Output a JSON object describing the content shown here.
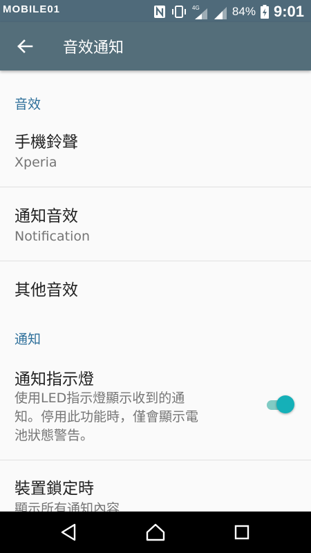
{
  "status_bar": {
    "watermark": "MOBILE01",
    "battery": "84%",
    "time": "9:01",
    "network": "4G",
    "icons": [
      "nfc-icon",
      "vibrate-icon",
      "signal-icon",
      "battery-icon"
    ]
  },
  "toolbar": {
    "back_icon": "arrow-left-icon",
    "title": "音效通知"
  },
  "sections": {
    "sound": {
      "header": "音效",
      "ringtone": {
        "title": "手機鈴聲",
        "value": "Xperia"
      },
      "notification_sound": {
        "title": "通知音效",
        "value": "Notification"
      },
      "other_sounds": {
        "title": "其他音效"
      }
    },
    "notification": {
      "header": "通知",
      "led": {
        "title": "通知指示燈",
        "summary_lines": [
          "使用LED指示燈顯示收到的通",
          "知。停用此功能時，僅會顯示電",
          "池狀態警告。"
        ],
        "enabled": true
      },
      "lock_screen": {
        "title": "裝置鎖定時",
        "value": "顯示所有通知內容"
      }
    }
  },
  "colors": {
    "status_bar": "#4f6a7a",
    "toolbar": "#546e7a",
    "accent": "#15b0b8",
    "section_header": "#2d6f9a"
  },
  "nav_bar": {
    "icons": [
      "back-triangle-icon",
      "home-icon",
      "recents-icon"
    ]
  }
}
